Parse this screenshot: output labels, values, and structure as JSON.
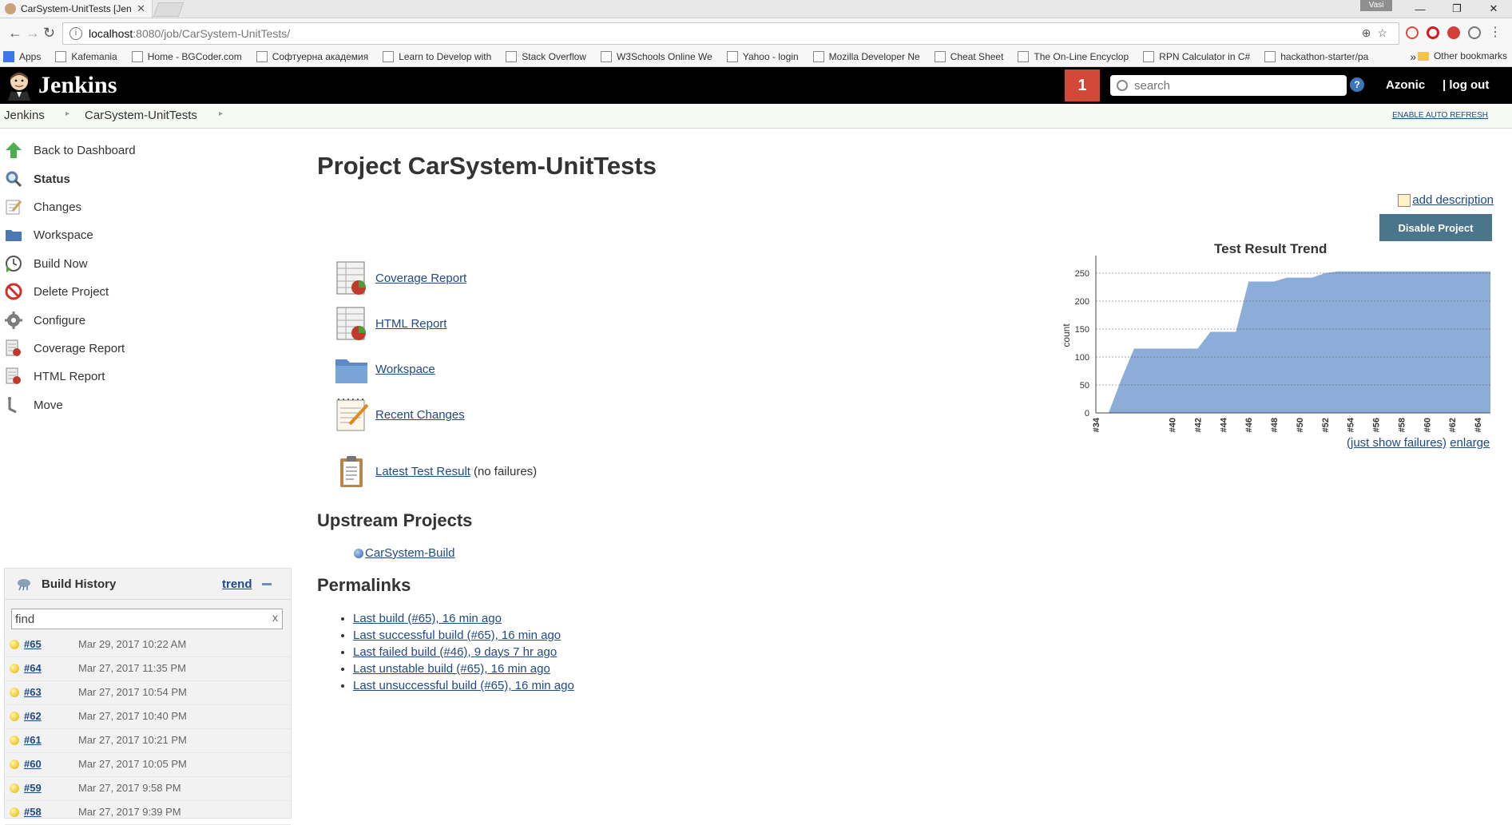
{
  "browser": {
    "tab_title": "CarSystem-UnitTests [Jen",
    "user_badge": "Vasi",
    "url_host": "localhost",
    "url_path": ":8080/job/CarSystem-UnitTests/",
    "bookmarks": [
      "Apps",
      "Kafemania",
      "Home - BGCoder.com",
      "Софтуерна академия",
      "Learn to Develop with",
      "Stack Overflow",
      "W3Schools Online We",
      "Yahoo - login",
      "Mozilla Developer Ne",
      "Cheat Sheet",
      "The On-Line Encyclop",
      "RPN Calculator in C#",
      "hackathon-starter/pa"
    ],
    "bookmarks_more": "»",
    "other_bookmarks": "Other bookmarks"
  },
  "header": {
    "logo_text": "Jenkins",
    "notification_count": "1",
    "search_placeholder": "search",
    "help": "?",
    "user": "Azonic",
    "logout": "| log out"
  },
  "breadcrumb": {
    "items": [
      "Jenkins",
      "CarSystem-UnitTests"
    ],
    "auto_refresh": "ENABLE AUTO REFRESH"
  },
  "side_tasks": [
    {
      "label": "Back to Dashboard",
      "icon": "up-arrow-icon",
      "color": "#4caf50"
    },
    {
      "label": "Status",
      "icon": "magnifier-icon",
      "color": "#5b7fa8"
    },
    {
      "label": "Changes",
      "icon": "notepad-icon",
      "color": "#c9a45a"
    },
    {
      "label": "Workspace",
      "icon": "folder-icon",
      "color": "#4a78b5"
    },
    {
      "label": "Build Now",
      "icon": "clock-play-icon",
      "color": "#5a9e3a"
    },
    {
      "label": "Delete Project",
      "icon": "no-entry-icon",
      "color": "#d0302a"
    },
    {
      "label": "Configure",
      "icon": "gear-icon",
      "color": "#7d7d7d"
    },
    {
      "label": "Coverage Report",
      "icon": "report-icon",
      "color": "#c0392b"
    },
    {
      "label": "HTML Report",
      "icon": "report-icon",
      "color": "#c0392b"
    },
    {
      "label": "Move",
      "icon": "move-icon",
      "color": "#777777"
    }
  ],
  "build_history": {
    "title": "Build History",
    "trend": "trend",
    "find_value": "find",
    "clear": "x",
    "rows": [
      {
        "num": "#65",
        "date": "Mar 29, 2017 10:22 AM"
      },
      {
        "num": "#64",
        "date": "Mar 27, 2017 11:35 PM"
      },
      {
        "num": "#63",
        "date": "Mar 27, 2017 10:54 PM"
      },
      {
        "num": "#62",
        "date": "Mar 27, 2017 10:40 PM"
      },
      {
        "num": "#61",
        "date": "Mar 27, 2017 10:21 PM"
      },
      {
        "num": "#60",
        "date": "Mar 27, 2017 10:05 PM"
      },
      {
        "num": "#59",
        "date": "Mar 27, 2017 9:58 PM"
      },
      {
        "num": "#58",
        "date": "Mar 27, 2017 9:39 PM"
      }
    ]
  },
  "main": {
    "title": "Project CarSystem-UnitTests",
    "add_description": "add description",
    "disable_project": "Disable Project",
    "links": [
      {
        "label": "Coverage Report",
        "icon": "report-pie-icon"
      },
      {
        "label": "HTML Report",
        "icon": "report-pie-icon"
      },
      {
        "label": "Workspace",
        "icon": "folder-icon"
      },
      {
        "label": "Recent Changes",
        "icon": "notepad-pencil-icon"
      }
    ],
    "latest_test_result": "Latest Test Result",
    "no_failures": "(no failures)",
    "upstream_title": "Upstream Projects",
    "upstream_project": "CarSystem-Build",
    "permalinks_title": "Permalinks",
    "permalinks": [
      "Last build (#65), 16 min ago",
      "Last successful build (#65), 16 min ago",
      "Last failed build (#46), 9 days 7 hr ago",
      "Last unstable build (#65), 16 min ago",
      "Last unsuccessful build (#65), 16 min ago"
    ],
    "just_show_failures": "(just show failures)",
    "enlarge": "enlarge"
  },
  "chart_data": {
    "type": "area",
    "title": "Test Result Trend",
    "ylabel": "count",
    "xlabel": "",
    "ylim": [
      0,
      270
    ],
    "y_ticks": [
      0,
      50,
      100,
      150,
      200,
      250
    ],
    "x_labels": [
      "#34",
      "#40",
      "#44",
      "#46",
      "#48",
      "#50",
      "#52",
      "#54",
      "#56",
      "#58",
      "#60",
      "#62",
      "#64"
    ],
    "x_tick_labels": [
      "#34",
      "#40",
      "#42",
      "#44",
      "#46",
      "#48",
      "#50",
      "#52",
      "#54",
      "#56",
      "#58",
      "#60",
      "#62",
      "#64"
    ],
    "x": [
      34,
      35,
      36,
      37,
      40,
      41,
      42,
      43,
      44,
      45,
      46,
      47,
      48,
      49,
      50,
      51,
      52,
      53,
      54,
      55,
      56,
      57,
      58,
      59,
      60,
      61,
      62,
      63,
      64,
      65
    ],
    "values": [
      0,
      0,
      60,
      115,
      115,
      115,
      115,
      145,
      145,
      145,
      235,
      235,
      235,
      242,
      242,
      242,
      250,
      253,
      253,
      253,
      253,
      253,
      253,
      253,
      253,
      253,
      253,
      253,
      253,
      253
    ],
    "grid": true,
    "fill_color": "#8badd8"
  }
}
